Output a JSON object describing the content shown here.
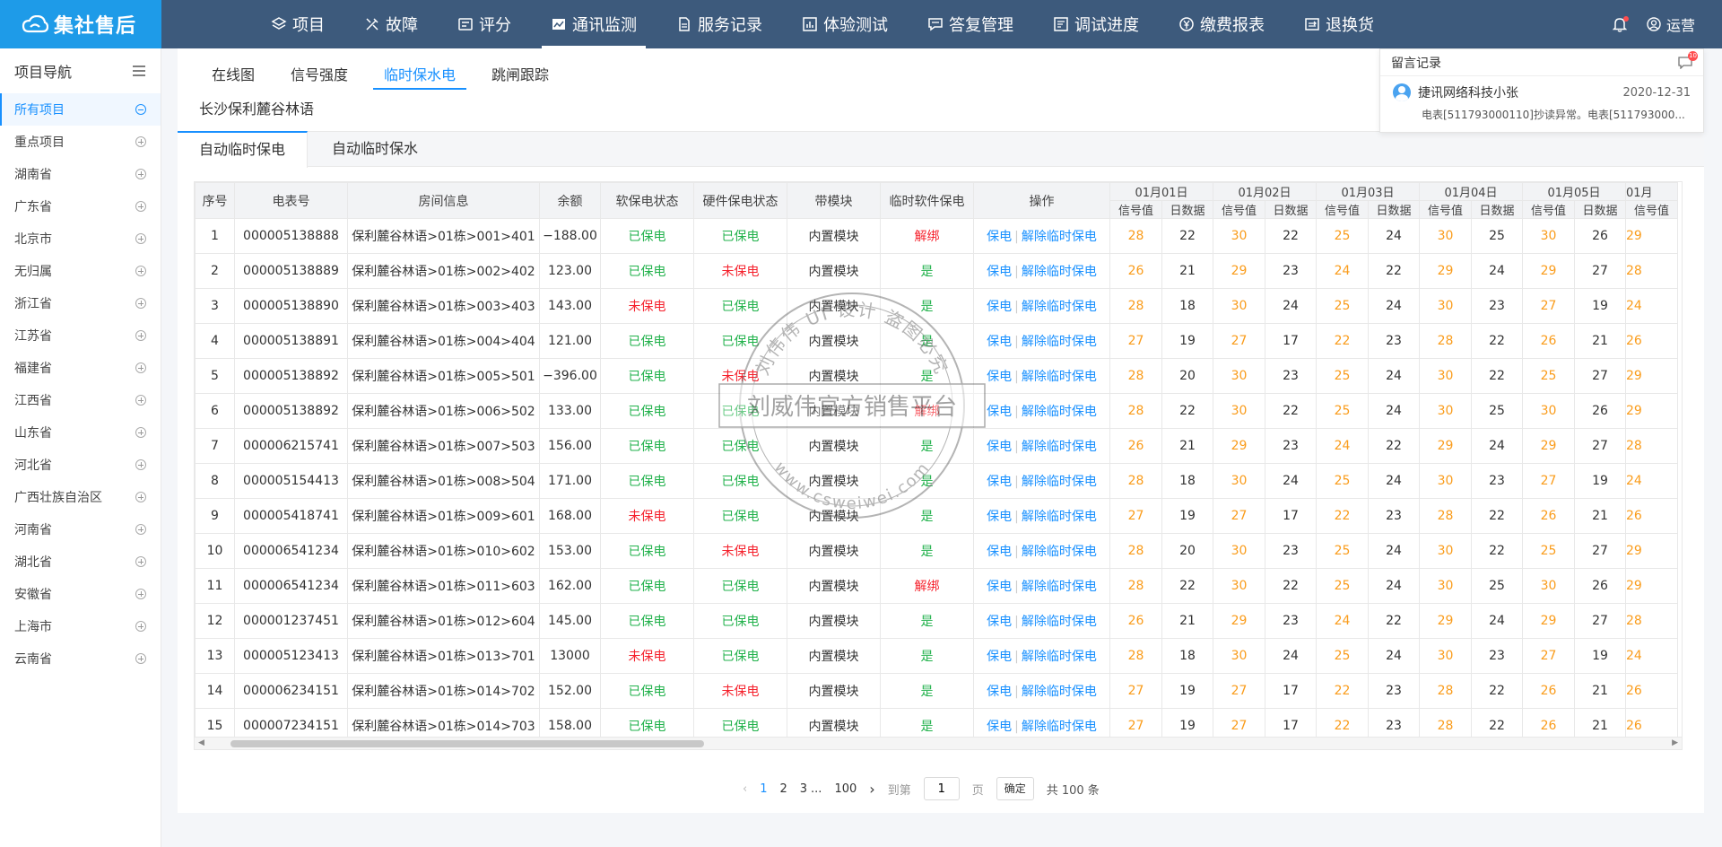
{
  "brand": {
    "name": "集社售后"
  },
  "nav": [
    {
      "label": "项目",
      "icon": "layers-icon",
      "active": false
    },
    {
      "label": "故障",
      "icon": "tools-icon",
      "active": false
    },
    {
      "label": "评分",
      "icon": "score-icon",
      "active": false
    },
    {
      "label": "通讯监测",
      "icon": "monitor-icon",
      "active": true
    },
    {
      "label": "服务记录",
      "icon": "document-icon",
      "active": false
    },
    {
      "label": "体验测试",
      "icon": "chart-icon",
      "active": false
    },
    {
      "label": "答复管理",
      "icon": "chat-icon",
      "active": false
    },
    {
      "label": "调试进度",
      "icon": "progress-icon",
      "active": false
    },
    {
      "label": "缴费报表",
      "icon": "yen-icon",
      "active": false
    },
    {
      "label": "退换货",
      "icon": "return-icon",
      "active": false
    }
  ],
  "user": {
    "name": "运营"
  },
  "sidebar": {
    "title": "项目导航",
    "items": [
      {
        "label": "所有项目",
        "active": true
      },
      {
        "label": "重点项目"
      },
      {
        "label": "湖南省"
      },
      {
        "label": "广东省"
      },
      {
        "label": "北京市"
      },
      {
        "label": "无归属"
      },
      {
        "label": "浙江省"
      },
      {
        "label": "江苏省"
      },
      {
        "label": "福建省"
      },
      {
        "label": "江西省"
      },
      {
        "label": "山东省"
      },
      {
        "label": "河北省"
      },
      {
        "label": "广西壮族自治区"
      },
      {
        "label": "河南省"
      },
      {
        "label": "湖北省"
      },
      {
        "label": "安徽省"
      },
      {
        "label": "上海市"
      },
      {
        "label": "云南省"
      }
    ]
  },
  "subtabs": [
    "在线图",
    "信号强度",
    "临时保水电",
    "跳闸跟踪"
  ],
  "active_subtab": 2,
  "project_title": "长沙保利麓谷林语",
  "mode_tabs": [
    "自动临时保电",
    "自动临时保水"
  ],
  "table": {
    "headers": {
      "index": "序号",
      "meter": "电表号",
      "room": "房间信息",
      "balance": "余额",
      "soft": "软保电状态",
      "hard": "硬件保电状态",
      "module": "带模块",
      "temp": "临时软件保电",
      "ops": "操作"
    },
    "dates": [
      "01月01日",
      "01月02日",
      "01月03日",
      "01月04日",
      "01月05日",
      "01月"
    ],
    "subheaders": [
      "信号值",
      "日数据"
    ],
    "ops": [
      "保电",
      "解除临时保电"
    ],
    "rows": [
      {
        "idx": "1",
        "meter": "000005138888",
        "room": "保利麓谷林语>01栋>001>401",
        "balance": "−188.00",
        "soft": "已保电",
        "hard": "已保电",
        "module": "内置模块",
        "temp": "解绑",
        "d": [
          "28",
          "22",
          "30",
          "22",
          "25",
          "24",
          "30",
          "25",
          "30",
          "26",
          "29"
        ]
      },
      {
        "idx": "2",
        "meter": "000005138889",
        "room": "保利麓谷林语>01栋>002>402",
        "balance": "123.00",
        "soft": "已保电",
        "hard": "未保电",
        "module": "内置模块",
        "temp": "是",
        "d": [
          "26",
          "21",
          "29",
          "23",
          "24",
          "22",
          "29",
          "24",
          "29",
          "27",
          "28"
        ]
      },
      {
        "idx": "3",
        "meter": "000005138890",
        "room": "保利麓谷林语>01栋>003>403",
        "balance": "143.00",
        "soft": "未保电",
        "hard": "已保电",
        "module": "内置模块",
        "temp": "是",
        "d": [
          "28",
          "18",
          "30",
          "24",
          "25",
          "24",
          "30",
          "23",
          "27",
          "19",
          "24"
        ]
      },
      {
        "idx": "4",
        "meter": "000005138891",
        "room": "保利麓谷林语>01栋>004>404",
        "balance": "121.00",
        "soft": "已保电",
        "hard": "已保电",
        "module": "内置模块",
        "temp": "是",
        "d": [
          "27",
          "19",
          "27",
          "17",
          "22",
          "23",
          "28",
          "22",
          "26",
          "21",
          "26"
        ]
      },
      {
        "idx": "5",
        "meter": "000005138892",
        "room": "保利麓谷林语>01栋>005>501",
        "balance": "−396.00",
        "soft": "已保电",
        "hard": "未保电",
        "module": "内置模块",
        "temp": "是",
        "d": [
          "28",
          "20",
          "30",
          "23",
          "25",
          "24",
          "30",
          "22",
          "25",
          "27",
          "29"
        ]
      },
      {
        "idx": "6",
        "meter": "000005138892",
        "room": "保利麓谷林语>01栋>006>502",
        "balance": "133.00",
        "soft": "已保电",
        "hard": "已保电",
        "module": "内置模块",
        "temp": "解绑",
        "d": [
          "28",
          "22",
          "30",
          "22",
          "25",
          "24",
          "30",
          "25",
          "30",
          "26",
          "29"
        ]
      },
      {
        "idx": "7",
        "meter": "000006215741",
        "room": "保利麓谷林语>01栋>007>503",
        "balance": "156.00",
        "soft": "已保电",
        "hard": "已保电",
        "module": "内置模块",
        "temp": "是",
        "d": [
          "26",
          "21",
          "29",
          "23",
          "24",
          "22",
          "29",
          "24",
          "29",
          "27",
          "28"
        ]
      },
      {
        "idx": "8",
        "meter": "000005154413",
        "room": "保利麓谷林语>01栋>008>504",
        "balance": "171.00",
        "soft": "已保电",
        "hard": "已保电",
        "module": "内置模块",
        "temp": "是",
        "d": [
          "28",
          "18",
          "30",
          "24",
          "25",
          "24",
          "30",
          "23",
          "27",
          "19",
          "24"
        ]
      },
      {
        "idx": "9",
        "meter": "000005418741",
        "room": "保利麓谷林语>01栋>009>601",
        "balance": "168.00",
        "soft": "未保电",
        "hard": "已保电",
        "module": "内置模块",
        "temp": "是",
        "d": [
          "27",
          "19",
          "27",
          "17",
          "22",
          "23",
          "28",
          "22",
          "26",
          "21",
          "26"
        ]
      },
      {
        "idx": "10",
        "meter": "000006541234",
        "room": "保利麓谷林语>01栋>010>602",
        "balance": "153.00",
        "soft": "已保电",
        "hard": "未保电",
        "module": "内置模块",
        "temp": "是",
        "d": [
          "28",
          "20",
          "30",
          "23",
          "25",
          "24",
          "30",
          "22",
          "25",
          "27",
          "29"
        ]
      },
      {
        "idx": "11",
        "meter": "000006541234",
        "room": "保利麓谷林语>01栋>011>603",
        "balance": "162.00",
        "soft": "已保电",
        "hard": "已保电",
        "module": "内置模块",
        "temp": "解绑",
        "d": [
          "28",
          "22",
          "30",
          "22",
          "25",
          "24",
          "30",
          "25",
          "30",
          "26",
          "29"
        ]
      },
      {
        "idx": "12",
        "meter": "000001237451",
        "room": "保利麓谷林语>01栋>012>604",
        "balance": "145.00",
        "soft": "已保电",
        "hard": "已保电",
        "module": "内置模块",
        "temp": "是",
        "d": [
          "26",
          "21",
          "29",
          "23",
          "24",
          "22",
          "29",
          "24",
          "29",
          "27",
          "28"
        ]
      },
      {
        "idx": "13",
        "meter": "000005123413",
        "room": "保利麓谷林语>01栋>013>701",
        "balance": "13000",
        "soft": "未保电",
        "hard": "已保电",
        "module": "内置模块",
        "temp": "是",
        "d": [
          "28",
          "18",
          "30",
          "24",
          "25",
          "24",
          "30",
          "23",
          "27",
          "19",
          "24"
        ]
      },
      {
        "idx": "14",
        "meter": "000006234151",
        "room": "保利麓谷林语>01栋>014>702",
        "balance": "152.00",
        "soft": "已保电",
        "hard": "未保电",
        "module": "内置模块",
        "temp": "是",
        "d": [
          "27",
          "19",
          "27",
          "17",
          "22",
          "23",
          "28",
          "22",
          "26",
          "21",
          "26"
        ]
      },
      {
        "idx": "15",
        "meter": "000007234151",
        "room": "保利麓谷林语>01栋>014>703",
        "balance": "158.00",
        "soft": "已保电",
        "hard": "已保电",
        "module": "内置模块",
        "temp": "是",
        "d": [
          "27",
          "19",
          "27",
          "17",
          "22",
          "23",
          "28",
          "22",
          "26",
          "21",
          "26"
        ]
      }
    ]
  },
  "pager": {
    "pages": [
      "1",
      "2",
      "3"
    ],
    "ellipsis": "...",
    "last": "100",
    "goto_label": "到第",
    "goto_value": "1",
    "page_unit": "页",
    "confirm": "确定",
    "total": "共 100 条"
  },
  "messages": {
    "title": "留言记录",
    "badge": "10",
    "from": "捷讯网络科技小张",
    "date": "2020-12-31",
    "text": "电表[511793000110]抄读异常。电表[511793000..."
  },
  "watermark": {
    "arc_top": "刘伟伟 UI 设计 盗图必究",
    "main": "刘威伟官方销售平台",
    "arc_bottom": "www.csweiwei.com"
  },
  "colors": {
    "topbar": "#3d5a7c",
    "brand": "#1e9be8",
    "accent": "#1890ff",
    "green": "#22b24c",
    "red": "#f5222d",
    "orange": "#fa9c1b"
  }
}
